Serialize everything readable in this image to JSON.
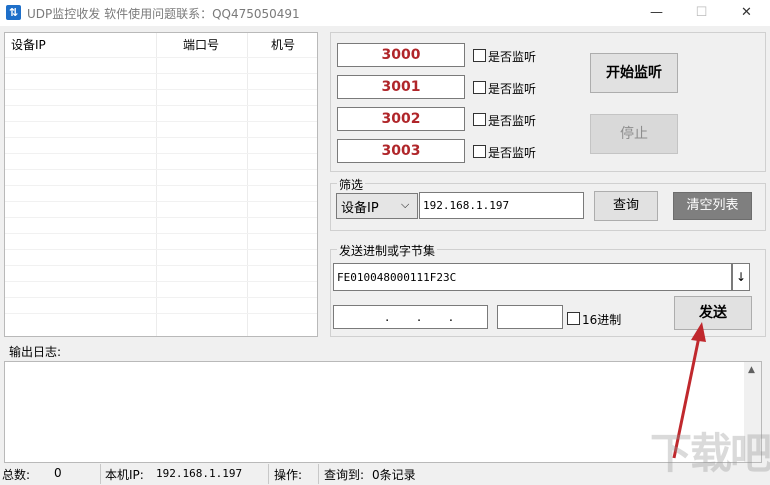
{
  "window": {
    "title": "UDP监控收发   软件使用问题联系：QQ475050491",
    "minimize_glyph": "—",
    "maximize_glyph": "☐",
    "close_glyph": "✕"
  },
  "table": {
    "headers": [
      "设备IP",
      "端口号",
      "机号"
    ]
  },
  "ports": [
    {
      "value": "3000",
      "checkbox_label": "是否监听"
    },
    {
      "value": "3001",
      "checkbox_label": "是否监听"
    },
    {
      "value": "3002",
      "checkbox_label": "是否监听"
    },
    {
      "value": "3003",
      "checkbox_label": "是否监听"
    }
  ],
  "buttons": {
    "start": "开始监听",
    "stop": "停止",
    "query": "查询",
    "clear": "清空列表",
    "send": "发送"
  },
  "filter": {
    "label": "筛选",
    "select_value": "设备IP",
    "ip_value": "192.168.1.197"
  },
  "send": {
    "label": "发送进制或字节集",
    "data_value": "FE010048000111F23C",
    "ip_value": "  .  .  .",
    "extra_value": "",
    "hex_label": "16进制"
  },
  "log": {
    "label": "输出日志:"
  },
  "status": {
    "total_label": "总数:",
    "total_value": "0",
    "local_ip_label": "本机IP:",
    "local_ip_value": "192.168.1.197",
    "op_label": "操作:",
    "query_label": "查询到:",
    "query_value": "0条记录"
  },
  "watermark": "下载吧",
  "colors": {
    "port_text": "#b0262a",
    "clear_button_bg": "#7f7f7f",
    "arrow": "#c0282d"
  }
}
